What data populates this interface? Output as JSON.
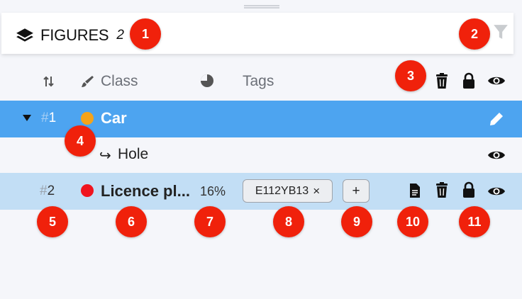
{
  "header": {
    "title": "FIGURES",
    "count": "2"
  },
  "columns": {
    "class_label": "Class",
    "tags_label": "Tags"
  },
  "figures": [
    {
      "number": "1",
      "hash": "#",
      "name": "Car",
      "color": "#f5a31a",
      "selected": true,
      "children": [
        {
          "name": "Hole",
          "arrow": "↪"
        }
      ]
    },
    {
      "number": "2",
      "hash": "#",
      "name": "Licence pl...",
      "color": "#f0141e",
      "percent": "16%",
      "tags": [
        {
          "text": "E112YB13",
          "remove": "×"
        }
      ],
      "add_tag": "+"
    }
  ],
  "badges": [
    "1",
    "2",
    "3",
    "4",
    "5",
    "6",
    "7",
    "8",
    "9",
    "10",
    "11"
  ],
  "colors": {
    "selected_row": "#4da4f0",
    "hover_row": "#c2def5",
    "badge": "#f0210b"
  },
  "icons": {
    "header": [
      "layers-icon",
      "filter-icon"
    ],
    "columns": [
      "sort-icon",
      "brush-icon",
      "pie-chart-icon",
      "trash-icon",
      "lock-icon",
      "eye-icon"
    ],
    "rows": [
      "caret-down-icon",
      "pencil-icon",
      "eye-icon",
      "document-icon",
      "trash-icon",
      "lock-icon"
    ]
  }
}
